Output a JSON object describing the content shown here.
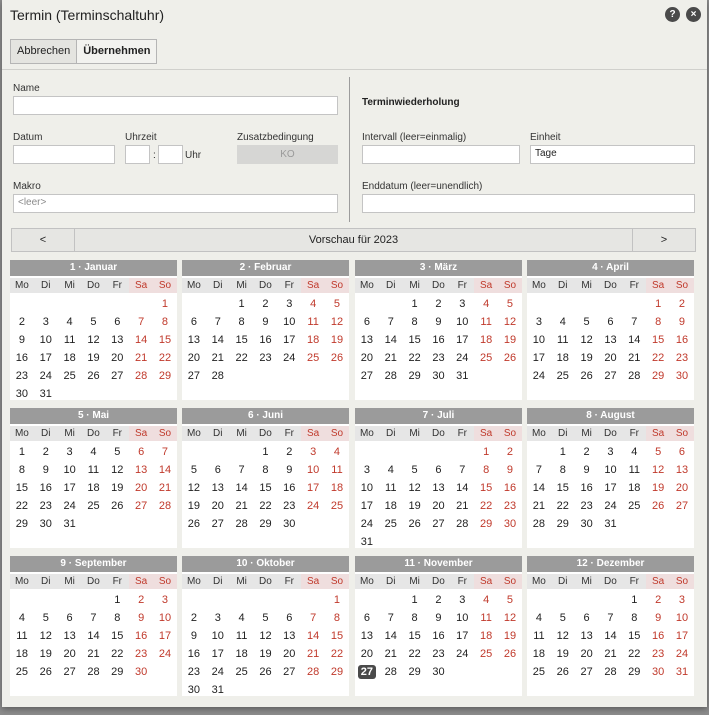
{
  "dialog": {
    "title": "Termin (Terminschaltuhr)",
    "help_glyph": "?",
    "close_glyph": "×"
  },
  "toolbar": {
    "cancel_label": "Abbrechen",
    "apply_label": "Übernehmen"
  },
  "form": {
    "name_label": "Name",
    "name_value": "",
    "datum_label": "Datum",
    "datum_value": "",
    "uhrzeit_label": "Uhrzeit",
    "hour_value": "",
    "minute_value": "",
    "uhr_suffix": "Uhr",
    "zusatz_label": "Zusatzbedingung",
    "zusatz_value": "KO",
    "makro_label": "Makro",
    "makro_placeholder": "<leer>"
  },
  "recurrence": {
    "heading": "Terminwiederholung",
    "intervall_label": "Intervall (leer=einmalig)",
    "intervall_value": "",
    "einheit_label": "Einheit",
    "einheit_value": "Tage",
    "enddatum_label": "Enddatum (leer=unendlich)",
    "enddatum_value": ""
  },
  "preview": {
    "prev": "<",
    "next": ">",
    "title": "Vorschau für 2023"
  },
  "weekdays": [
    "Mo",
    "Di",
    "Mi",
    "Do",
    "Fr",
    "Sa",
    "So"
  ],
  "today": {
    "month": 11,
    "day": 27
  },
  "months": [
    {
      "title": "1 · Januar",
      "offset": 6,
      "days": 31
    },
    {
      "title": "2 · Februar",
      "offset": 2,
      "days": 28
    },
    {
      "title": "3 · März",
      "offset": 2,
      "days": 31
    },
    {
      "title": "4 · April",
      "offset": 5,
      "days": 30
    },
    {
      "title": "5 · Mai",
      "offset": 0,
      "days": 31
    },
    {
      "title": "6 · Juni",
      "offset": 3,
      "days": 30
    },
    {
      "title": "7 · Juli",
      "offset": 5,
      "days": 31
    },
    {
      "title": "8 · August",
      "offset": 1,
      "days": 31
    },
    {
      "title": "9 · September",
      "offset": 4,
      "days": 30
    },
    {
      "title": "10 · Oktober",
      "offset": 6,
      "days": 31
    },
    {
      "title": "11 · November",
      "offset": 2,
      "days": 30
    },
    {
      "title": "12 · Dezember",
      "offset": 4,
      "days": 31
    }
  ]
}
